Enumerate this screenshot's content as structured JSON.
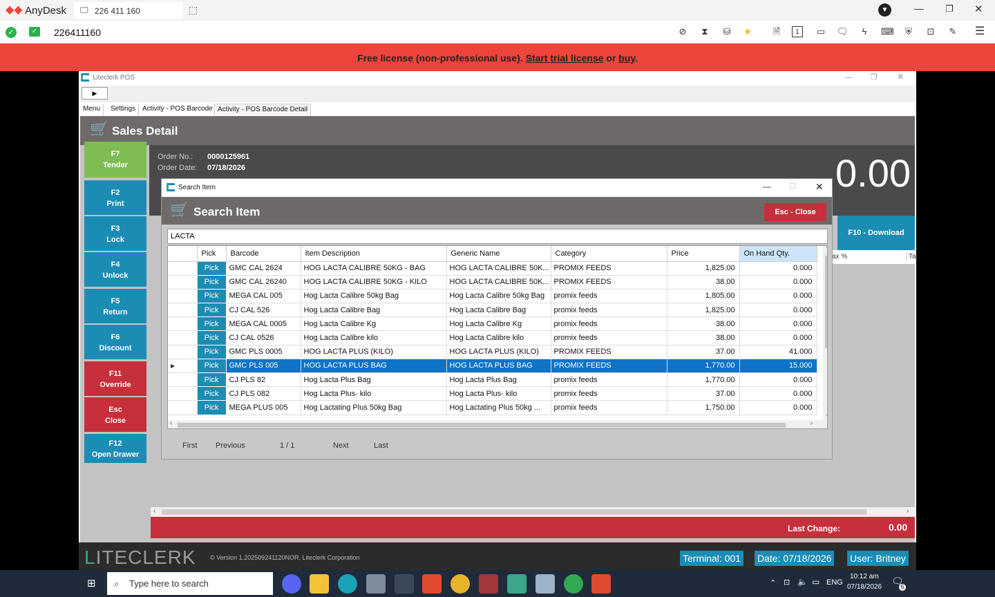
{
  "anydesk": {
    "app_name": "AnyDesk",
    "tab_address": "226 411 160",
    "address_value": "226411160",
    "banner_prefix": "Free license (non-professional use). ",
    "banner_link1": "Start trial license",
    "banner_mid": " or ",
    "banner_link2": "buy",
    "banner_suffix": "."
  },
  "liteclerk": {
    "window_title": "Liteclerk POS",
    "nav_arrow": "▶",
    "tabs": [
      "Menu",
      "Settings",
      "Activity - POS Barcode",
      "Activity - POS Barcode Detail"
    ],
    "page_title": "Sales Detail",
    "fkeys": [
      {
        "key": "F7",
        "label": "Tender"
      },
      {
        "key": "F2",
        "label": "Print"
      },
      {
        "key": "F3",
        "label": "Lock"
      },
      {
        "key": "F4",
        "label": "Unlock"
      },
      {
        "key": "F5",
        "label": "Return"
      },
      {
        "key": "F6",
        "label": "Discount"
      },
      {
        "key": "F11",
        "label": "Override"
      },
      {
        "key": "Esc",
        "label": "Close"
      },
      {
        "key": "F12",
        "label": "Open Drawer"
      }
    ],
    "order_no_label": "Order No.:",
    "order_no": "0000125961",
    "order_date_label": "Order Date:",
    "order_date": "07/18/2026",
    "big_amount": "0.00",
    "f10_label": "F10 - Download",
    "tax_col1": "ax %",
    "tax_col2": "Ta:",
    "last_change_label": "Last Change:",
    "last_change_value": "0.00",
    "logo_first": "L",
    "logo_rest": "ITECLERK",
    "version": "© Version 1.202509241120NOR, Liteclerk Corporation",
    "terminal": "Terminal: 001",
    "date": "Date: 07/18/2026",
    "user": "User: Britney"
  },
  "search_dialog": {
    "title": "Search Item",
    "header": "Search Item",
    "close_button": "Esc - Close",
    "search_value": "LACTA",
    "columns": [
      "Pick",
      "Barcode",
      "Item Description",
      "Generic Name",
      "Category",
      "Price",
      "On Hand Qty."
    ],
    "pick_label": "Pick",
    "rows": [
      {
        "barcode": "GMC CAL 2624",
        "desc": "HOG LACTA CALIBRE 50KG - BAG",
        "generic": "HOG LACTA CALIBRE 50K...",
        "category": "PROMIX FEEDS",
        "price": "1,825.00",
        "qty": "0.000"
      },
      {
        "barcode": "GMC CAL 26240",
        "desc": "HOG LACTA CALIBRE 50KG - KILO",
        "generic": "HOG LACTA CALIBRE 50K...",
        "category": "PROMIX FEEDS",
        "price": "38.00",
        "qty": "0.000"
      },
      {
        "barcode": "MEGA CAL 005",
        "desc": "Hog Lacta Calibre 50kg Bag",
        "generic": "Hog Lacta Calibre 50kg Bag",
        "category": "promix feeds",
        "price": "1,805.00",
        "qty": "0.000"
      },
      {
        "barcode": "CJ CAL 526",
        "desc": "Hog Lacta Calibre Bag",
        "generic": "Hog Lacta Calibre Bag",
        "category": "promix feeds",
        "price": "1,825.00",
        "qty": "0.000"
      },
      {
        "barcode": "MEGA CAL 0005",
        "desc": "Hog Lacta Calibre Kg",
        "generic": "Hog Lacta Calibre Kg",
        "category": "promix feeds",
        "price": "38.00",
        "qty": "0.000"
      },
      {
        "barcode": "CJ CAL 0526",
        "desc": "Hog Lacta Calibre kilo",
        "generic": "Hog Lacta Calibre kilo",
        "category": "promix feeds",
        "price": "38.00",
        "qty": "0.000"
      },
      {
        "barcode": "GMC PLS 0005",
        "desc": "HOG LACTA PLUS (KILO)",
        "generic": "HOG LACTA PLUS (KILO)",
        "category": "PROMIX FEEDS",
        "price": "37.00",
        "qty": "41.000"
      },
      {
        "barcode": "GMC PLS 005",
        "desc": "HOG LACTA PLUS BAG",
        "generic": "HOG LACTA PLUS BAG",
        "category": "PROMIX FEEDS",
        "price": "1,770.00",
        "qty": "15.000",
        "selected": true
      },
      {
        "barcode": "CJ PLS 82",
        "desc": "Hog Lacta Plus Bag",
        "generic": "Hog Lacta Plus Bag",
        "category": "promix feeds",
        "price": "1,770.00",
        "qty": "0.000"
      },
      {
        "barcode": "CJ PLS 082",
        "desc": "Hog Lacta Plus- kilo",
        "generic": "Hog Lacta Plus- kilo",
        "category": "promix feeds",
        "price": "37.00",
        "qty": "0.000"
      },
      {
        "barcode": "MEGA PLUS 005",
        "desc": "Hog Lactating Plus 50kg Bag",
        "generic": "Hog Lactating Plus 50kg ...",
        "category": "promix feeds",
        "price": "1,750.00",
        "qty": "0.000"
      }
    ],
    "pager": {
      "first": "First",
      "previous": "Previous",
      "page": "1 / 1",
      "next": "Next",
      "last": "Last"
    }
  },
  "taskbar": {
    "search_placeholder": "Type here to search",
    "lang": "ENG",
    "time": "10:12 am",
    "date": "07/18/2026",
    "notif_count": "6"
  },
  "colors": {
    "accent_blue": "#1b8db5",
    "accent_red": "#c62f3b",
    "accent_green": "#7dbd52",
    "banner_red": "#ef443b",
    "selected_row": "#0f73c7"
  }
}
